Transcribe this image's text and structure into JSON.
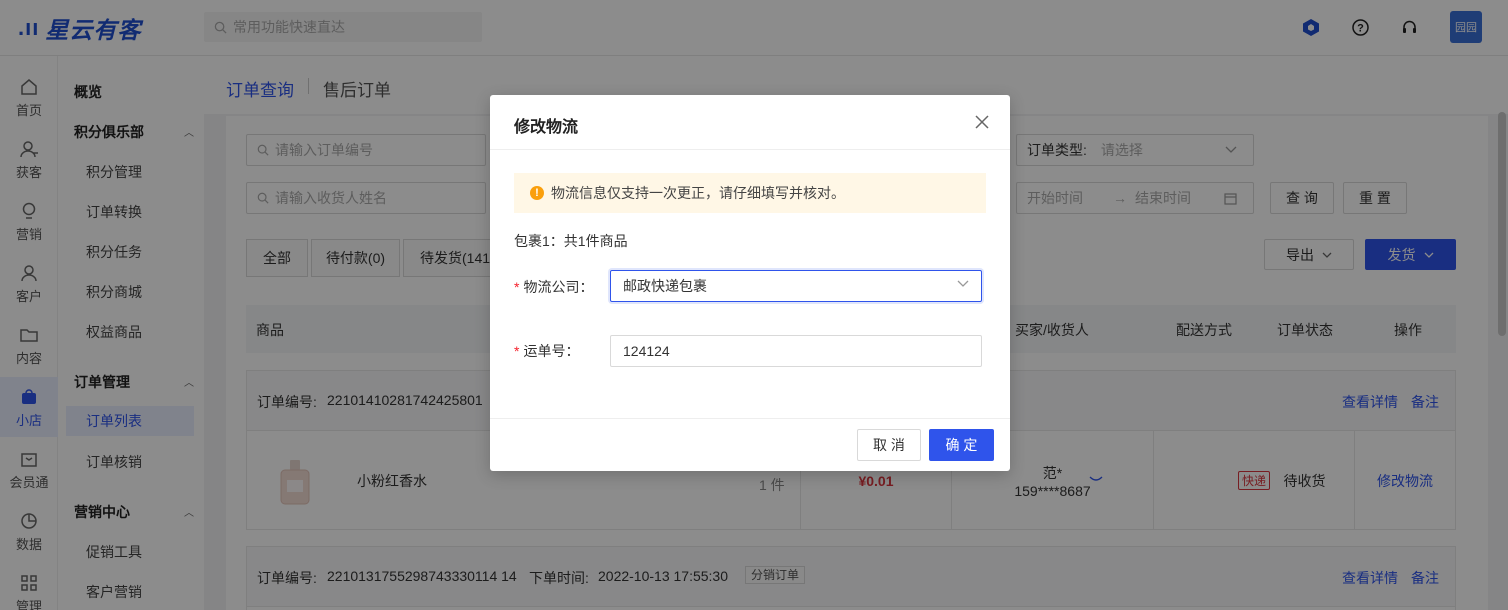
{
  "app": {
    "logo_mark": ".ıı",
    "logo_text": "星云有客"
  },
  "header": {
    "search_placeholder": "常用功能快速直达",
    "avatar_text": "园园"
  },
  "rail": [
    {
      "label": "首页",
      "icon": "home-icon"
    },
    {
      "label": "获客",
      "icon": "user-add-icon"
    },
    {
      "label": "营销",
      "icon": "bulb-icon"
    },
    {
      "label": "客户",
      "icon": "user-icon"
    },
    {
      "label": "内容",
      "icon": "folder-icon"
    },
    {
      "label": "小店",
      "icon": "shop-icon",
      "active": true
    },
    {
      "label": "会员通",
      "icon": "member-icon"
    },
    {
      "label": "数据",
      "icon": "chart-icon"
    },
    {
      "label": "管理",
      "icon": "grid-icon"
    }
  ],
  "subnav": {
    "overview": "概览",
    "points_club": "积分俱乐部",
    "points_items": [
      "积分管理",
      "订单转换",
      "积分任务",
      "积分商城",
      "权益商品"
    ],
    "order_mgmt": "订单管理",
    "order_items": [
      "订单列表",
      "订单核销"
    ],
    "marketing_center": "营销中心",
    "marketing_items": [
      "促销工具",
      "客户营销"
    ]
  },
  "page": {
    "tabs": [
      "订单查询",
      "售后订单"
    ],
    "filters": {
      "order_no_placeholder": "请输入订单编号",
      "receiver_placeholder": "请输入收货人姓名",
      "order_type_label": "订单类型:",
      "order_type_placeholder": "请选择",
      "start_time": "开始时间",
      "end_time": "结束时间",
      "query": "查 询",
      "reset": "重 置"
    },
    "status_tabs": [
      "全部",
      "待付款(0)",
      "待发货(141)"
    ],
    "export": "导出",
    "ship": "发货",
    "columns": {
      "product": "商品",
      "buyer": "买家/收货人",
      "delivery": "配送方式",
      "status": "订单状态",
      "ops": "操作"
    },
    "orders": [
      {
        "order_no_label": "订单编号:",
        "order_no": "22101410281742425801",
        "view": "查看详情",
        "note": "备注",
        "product": "小粉红香水",
        "qty": "1 件",
        "price": "¥0.01",
        "buyer_name": "范*",
        "buyer_phone": "159****8687",
        "delivery": "快递",
        "status": "待收货",
        "op": "修改物流"
      },
      {
        "order_no_label": "订单编号:",
        "order_no": "2210131755298743330114 14",
        "order_time_label": "下单时间:",
        "order_time": "2022-10-13 17:55:30",
        "tag": "分销订单",
        "view": "查看详情",
        "note": "备注"
      }
    ]
  },
  "modal": {
    "title": "修改物流",
    "notice": "物流信息仅支持一次更正，请仔细填写并核对。",
    "package": "包裹1：共1件商品",
    "company_label": "物流公司：",
    "company_value": "邮政快递包裹",
    "tracking_label": "运单号：",
    "tracking_value": "124124",
    "cancel": "取 消",
    "confirm": "确 定"
  },
  "colors": {
    "primary": "#2f54eb",
    "warning": "#fa9f0c",
    "danger": "#d9363e"
  }
}
